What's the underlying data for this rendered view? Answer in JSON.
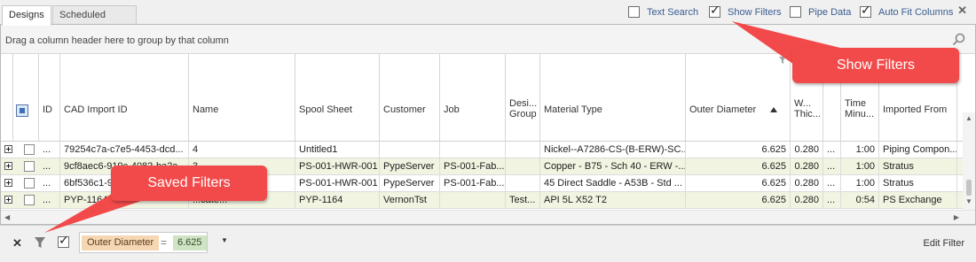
{
  "tabs": [
    {
      "label": "Designs",
      "active": true
    },
    {
      "label": "Scheduled Parts",
      "active": false
    }
  ],
  "options": [
    {
      "label": "Text Search",
      "checked": false
    },
    {
      "label": "Show Filters",
      "checked": true
    },
    {
      "label": "Pipe Data",
      "checked": false
    },
    {
      "label": "Auto Fit Columns",
      "checked": true
    }
  ],
  "group_panel_text": "Drag a column header here to group by that column",
  "columns": [
    {
      "key": "id",
      "label": "ID"
    },
    {
      "key": "cad",
      "label": "CAD Import ID"
    },
    {
      "key": "name",
      "label": "Name"
    },
    {
      "key": "spool",
      "label": "Spool Sheet"
    },
    {
      "key": "customer",
      "label": "Customer"
    },
    {
      "key": "job",
      "label": "Job"
    },
    {
      "key": "design_group",
      "label": "Design Group",
      "display": "Desi... Group"
    },
    {
      "key": "material",
      "label": "Material Type"
    },
    {
      "key": "od",
      "label": "Outer Diameter"
    },
    {
      "key": "wall",
      "label": "Wall Thickness",
      "display": "W... Thic..."
    },
    {
      "key": "blank",
      "label": ""
    },
    {
      "key": "time",
      "label": "Time Minutes",
      "display": "Time Minu..."
    },
    {
      "key": "imported",
      "label": "Imported From",
      "display": "Imported From"
    }
  ],
  "rows": [
    {
      "id": "...",
      "cad": "79254c7a-c7e5-4453-dcd...",
      "name": "4",
      "spool": "Untitled1",
      "customer": "",
      "job": "",
      "design_group": "",
      "material": "Nickel--A7286-CS-(B-ERW)-SC...",
      "od": "6.625",
      "wall": "0.280",
      "blank": "...",
      "time": "1:00",
      "imported": "Piping Compon..."
    },
    {
      "id": "...",
      "cad": "9cf8aec6-919c-4082-ba2a...",
      "name": "3",
      "spool": "PS-001-HWR-001",
      "customer": "PypeServer",
      "job": "PS-001-Fab...",
      "design_group": "",
      "material": "Copper - B75 - Sch 40 - ERW -...",
      "od": "6.625",
      "wall": "0.280",
      "blank": "...",
      "time": "1:00",
      "imported": "Stratus"
    },
    {
      "id": "...",
      "cad": "6bf536c1-92db-451f-b4b...",
      "name": "4",
      "spool": "PS-001-HWR-001",
      "customer": "PypeServer",
      "job": "PS-001-Fab...",
      "design_group": "",
      "material": "45 Direct Saddle - A53B - Std ...",
      "od": "6.625",
      "wall": "0.280",
      "blank": "...",
      "time": "1:00",
      "imported": "Stratus"
    },
    {
      "id": "...",
      "cad": "PYP-1164 PY...",
      "name": "...cate...",
      "spool": "PYP-1164",
      "customer": "VernonTst",
      "job": "",
      "design_group": "Test...",
      "material": "API 5L X52 T2",
      "od": "6.625",
      "wall": "0.280",
      "blank": "...",
      "time": "0:54",
      "imported": "PS Exchange"
    }
  ],
  "filter_bar": {
    "field": "Outer Diameter",
    "operator": "=",
    "value": "6.625",
    "edit_label": "Edit Filter"
  },
  "callouts": {
    "show_filters": "Show Filters",
    "saved_filters": "Saved Filters"
  },
  "colors": {
    "callout": "#f24a4a",
    "alt_row": "#f0f4e0",
    "option_text": "#3a5d91"
  }
}
